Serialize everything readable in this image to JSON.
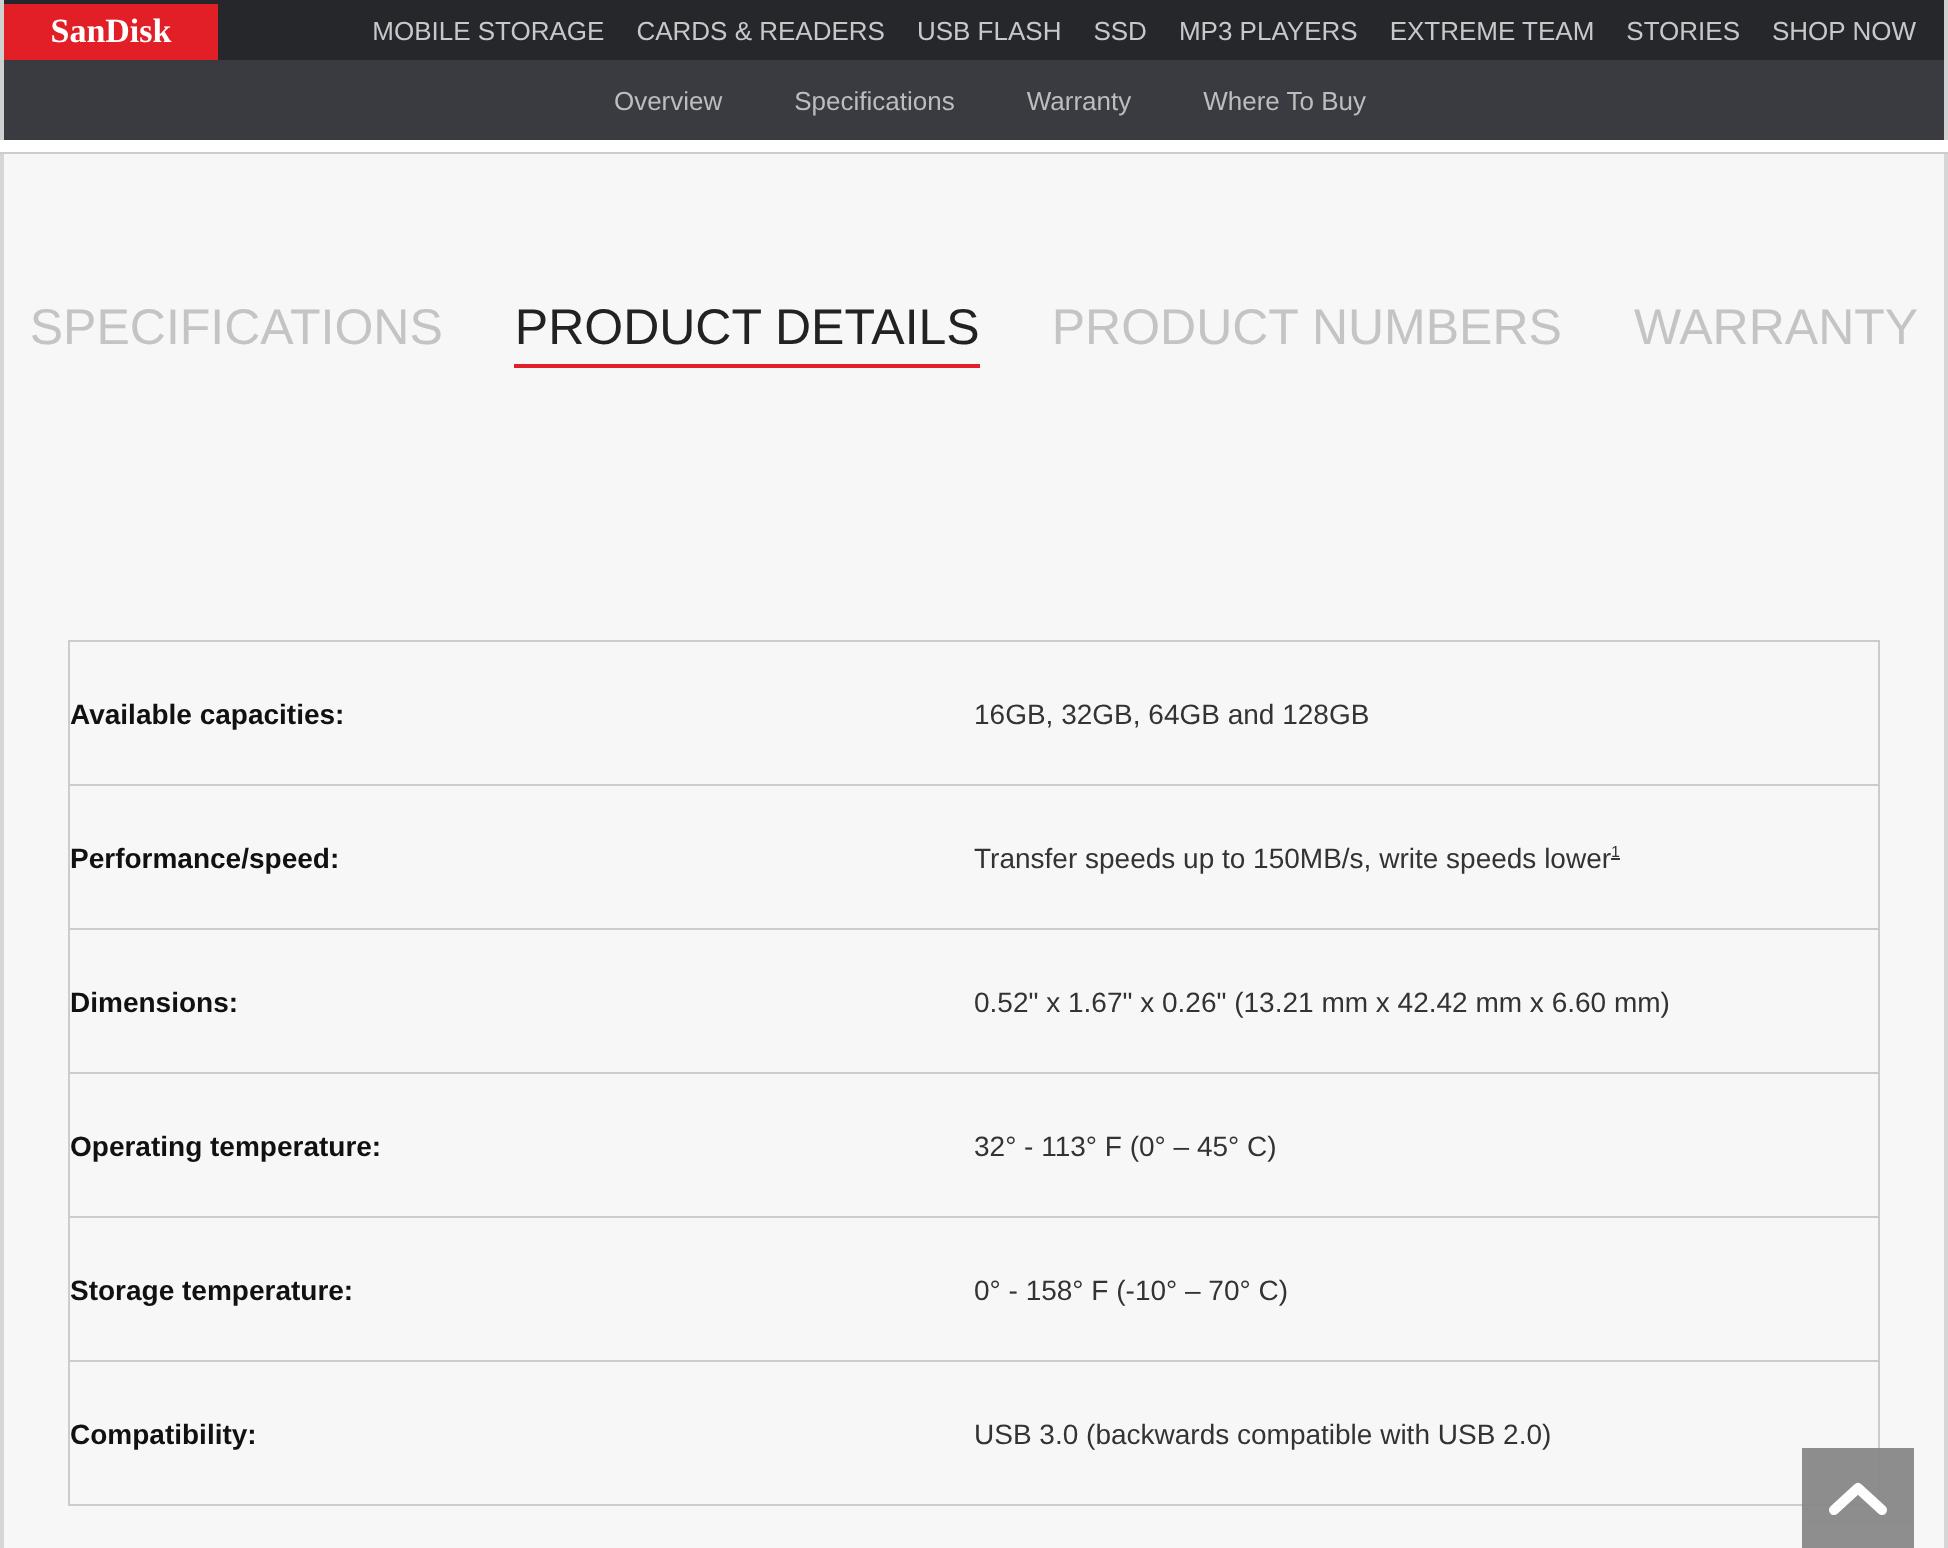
{
  "brand": {
    "logo": "SanDisk"
  },
  "main_nav": [
    "MOBILE STORAGE",
    "CARDS & READERS",
    "USB FLASH",
    "SSD",
    "MP3 PLAYERS",
    "EXTREME TEAM",
    "STORIES",
    "SHOP NOW"
  ],
  "sub_nav": [
    "Overview",
    "Specifications",
    "Warranty",
    "Where To Buy"
  ],
  "tabs": [
    {
      "label": "SPECIFICATIONS",
      "selected": false
    },
    {
      "label": "PRODUCT DETAILS",
      "selected": true
    },
    {
      "label": "PRODUCT NUMBERS",
      "selected": false
    },
    {
      "label": "WARRANTY",
      "selected": false
    }
  ],
  "specs": [
    {
      "label": "Available capacities:",
      "value": "16GB, 32GB, 64GB and 128GB"
    },
    {
      "label": "Performance/speed:",
      "value": "Transfer speeds up to 150MB/s, write speeds lower$^{1}$"
    },
    {
      "label": "Dimensions:",
      "value": "0.52\" x 1.67\" x 0.26\" (13.21 mm x 42.42 mm x 6.60 mm)"
    },
    {
      "label": "Operating temperature:",
      "value": "32° - 113° F (0° – 45° C)"
    },
    {
      "label": "Storage temperature:",
      "value": "0° - 158° F (-10° – 70° C)"
    },
    {
      "label": "Compatibility:",
      "value": "USB 3.0 (backwards compatible with USB 2.0)"
    }
  ]
}
